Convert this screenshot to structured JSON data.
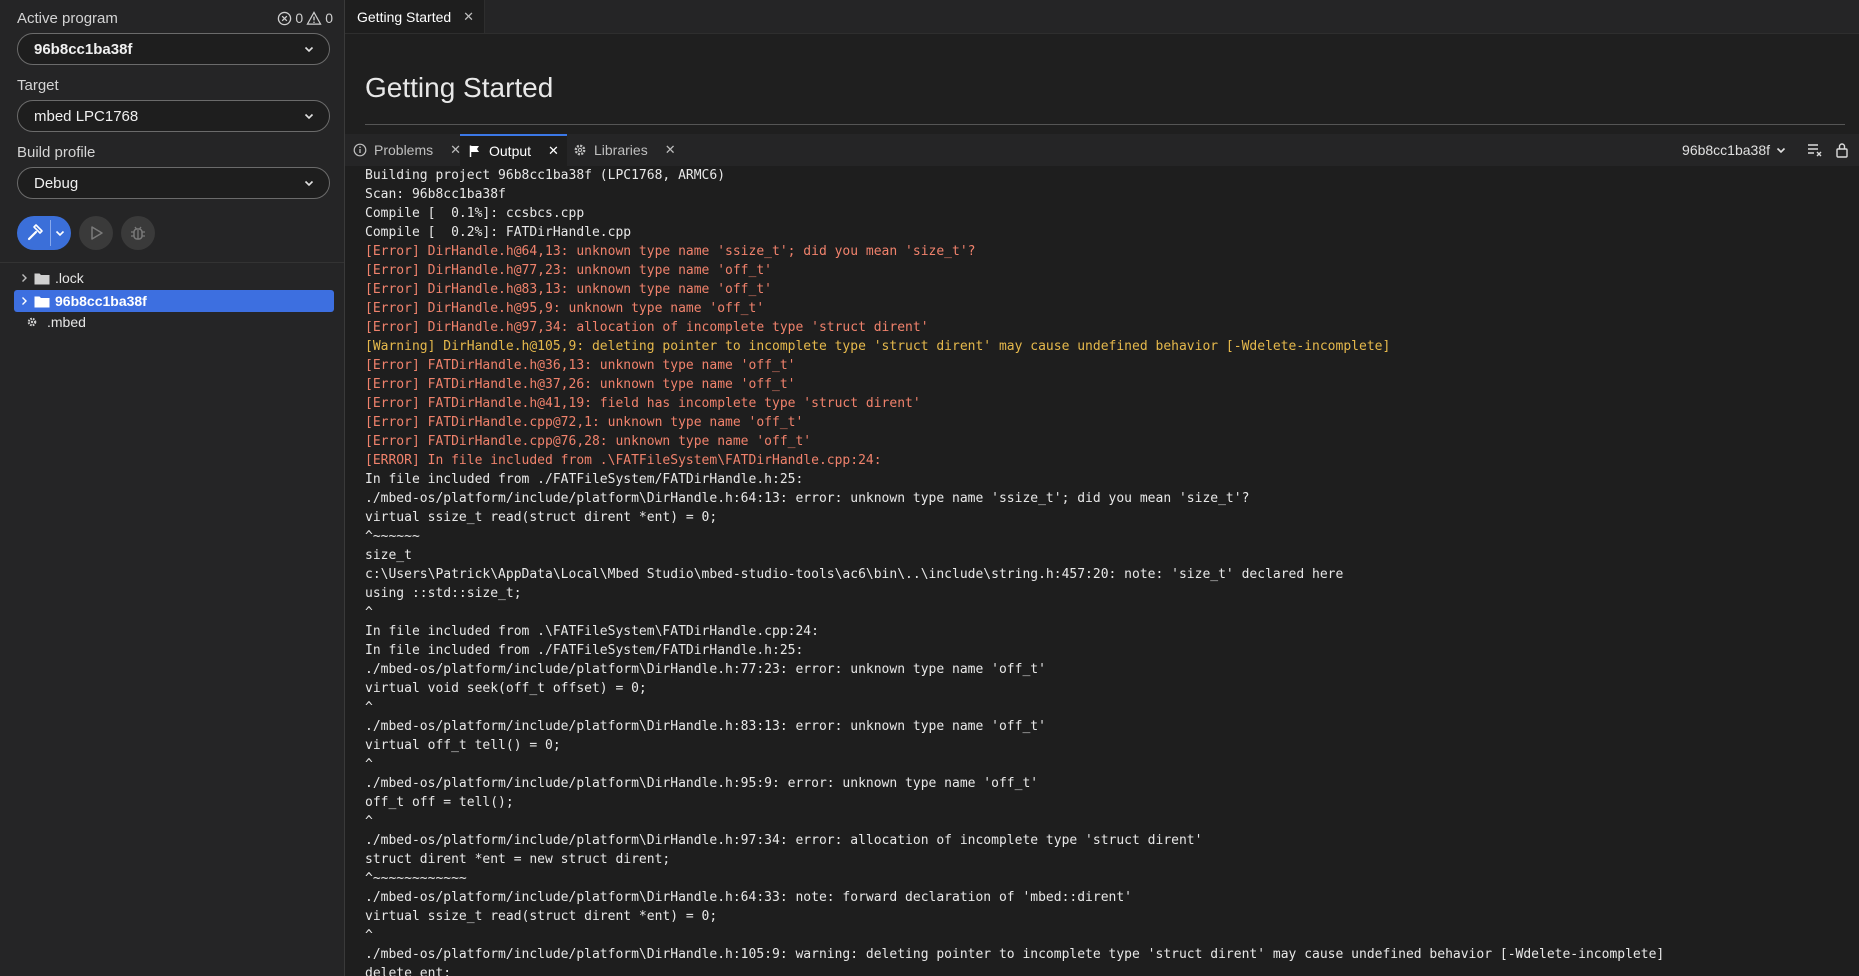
{
  "sidebar": {
    "active_program_label": "Active program",
    "error_count": "0",
    "warning_count": "0",
    "active_program_value": "96b8cc1ba38f",
    "target_label": "Target",
    "target_value": "mbed LPC1768",
    "build_profile_label": "Build profile",
    "build_profile_value": "Debug",
    "tree": [
      {
        "label": ".lock",
        "type": "folder"
      },
      {
        "label": "96b8cc1ba38f",
        "type": "folder",
        "selected": true
      },
      {
        "label": ".mbed",
        "type": "file"
      }
    ]
  },
  "editor": {
    "tab_label": "Getting Started",
    "page_title": "Getting Started"
  },
  "panel": {
    "tabs": [
      {
        "label": "Problems"
      },
      {
        "label": "Output",
        "active": true
      },
      {
        "label": "Libraries"
      }
    ],
    "output_source": "96b8cc1ba38f",
    "output_lines": [
      {
        "text": "Building project 96b8cc1ba38f (LPC1768, ARMC6)",
        "level": "info"
      },
      {
        "text": "Scan: 96b8cc1ba38f",
        "level": "info"
      },
      {
        "text": "Compile [  0.1%]: ccsbcs.cpp",
        "level": "info"
      },
      {
        "text": "Compile [  0.2%]: FATDirHandle.cpp",
        "level": "info"
      },
      {
        "text": "[Error] DirHandle.h@64,13: unknown type name 'ssize_t'; did you mean 'size_t'?",
        "level": "error"
      },
      {
        "text": "[Error] DirHandle.h@77,23: unknown type name 'off_t'",
        "level": "error"
      },
      {
        "text": "[Error] DirHandle.h@83,13: unknown type name 'off_t'",
        "level": "error"
      },
      {
        "text": "[Error] DirHandle.h@95,9: unknown type name 'off_t'",
        "level": "error"
      },
      {
        "text": "[Error] DirHandle.h@97,34: allocation of incomplete type 'struct dirent'",
        "level": "error"
      },
      {
        "text": "[Warning] DirHandle.h@105,9: deleting pointer to incomplete type 'struct dirent' may cause undefined behavior [-Wdelete-incomplete]",
        "level": "warning"
      },
      {
        "text": "[Error] FATDirHandle.h@36,13: unknown type name 'off_t'",
        "level": "error"
      },
      {
        "text": "[Error] FATDirHandle.h@37,26: unknown type name 'off_t'",
        "level": "error"
      },
      {
        "text": "[Error] FATDirHandle.h@41,19: field has incomplete type 'struct dirent'",
        "level": "error"
      },
      {
        "text": "[Error] FATDirHandle.cpp@72,1: unknown type name 'off_t'",
        "level": "error"
      },
      {
        "text": "[Error] FATDirHandle.cpp@76,28: unknown type name 'off_t'",
        "level": "error"
      },
      {
        "text": "[ERROR] In file included from .\\FATFileSystem\\FATDirHandle.cpp:24:",
        "level": "error"
      },
      {
        "text": "In file included from ./FATFileSystem/FATDirHandle.h:25:",
        "level": "info"
      },
      {
        "text": "./mbed-os/platform/include/platform\\DirHandle.h:64:13: error: unknown type name 'ssize_t'; did you mean 'size_t'?",
        "level": "info"
      },
      {
        "text": "virtual ssize_t read(struct dirent *ent) = 0;",
        "level": "info"
      },
      {
        "text": "^~~~~~~",
        "level": "info"
      },
      {
        "text": "size_t",
        "level": "info"
      },
      {
        "text": "c:\\Users\\Patrick\\AppData\\Local\\Mbed Studio\\mbed-studio-tools\\ac6\\bin\\..\\include\\string.h:457:20: note: 'size_t' declared here",
        "level": "info"
      },
      {
        "text": "using ::std::size_t;",
        "level": "info"
      },
      {
        "text": "^",
        "level": "info"
      },
      {
        "text": "In file included from .\\FATFileSystem\\FATDirHandle.cpp:24:",
        "level": "info"
      },
      {
        "text": "In file included from ./FATFileSystem/FATDirHandle.h:25:",
        "level": "info"
      },
      {
        "text": "./mbed-os/platform/include/platform\\DirHandle.h:77:23: error: unknown type name 'off_t'",
        "level": "info"
      },
      {
        "text": "virtual void seek(off_t offset) = 0;",
        "level": "info"
      },
      {
        "text": "^",
        "level": "info"
      },
      {
        "text": "./mbed-os/platform/include/platform\\DirHandle.h:83:13: error: unknown type name 'off_t'",
        "level": "info"
      },
      {
        "text": "virtual off_t tell() = 0;",
        "level": "info"
      },
      {
        "text": "^",
        "level": "info"
      },
      {
        "text": "./mbed-os/platform/include/platform\\DirHandle.h:95:9: error: unknown type name 'off_t'",
        "level": "info"
      },
      {
        "text": "off_t off = tell();",
        "level": "info"
      },
      {
        "text": "^",
        "level": "info"
      },
      {
        "text": "./mbed-os/platform/include/platform\\DirHandle.h:97:34: error: allocation of incomplete type 'struct dirent'",
        "level": "info"
      },
      {
        "text": "struct dirent *ent = new struct dirent;",
        "level": "info"
      },
      {
        "text": "^~~~~~~~~~~~~",
        "level": "info"
      },
      {
        "text": "./mbed-os/platform/include/platform\\DirHandle.h:64:33: note: forward declaration of 'mbed::dirent'",
        "level": "info"
      },
      {
        "text": "virtual ssize_t read(struct dirent *ent) = 0;",
        "level": "info"
      },
      {
        "text": "^",
        "level": "info"
      },
      {
        "text": "./mbed-os/platform/include/platform\\DirHandle.h:105:9: warning: deleting pointer to incomplete type 'struct dirent' may cause undefined behavior [-Wdelete-incomplete]",
        "level": "info"
      },
      {
        "text": "delete ent;",
        "level": "info"
      }
    ]
  },
  "colors": {
    "accent": "#3b6fd9",
    "error_text": "#f0826c",
    "warning_text": "#e6b94c",
    "selected_tree": "#3d6fe0"
  }
}
